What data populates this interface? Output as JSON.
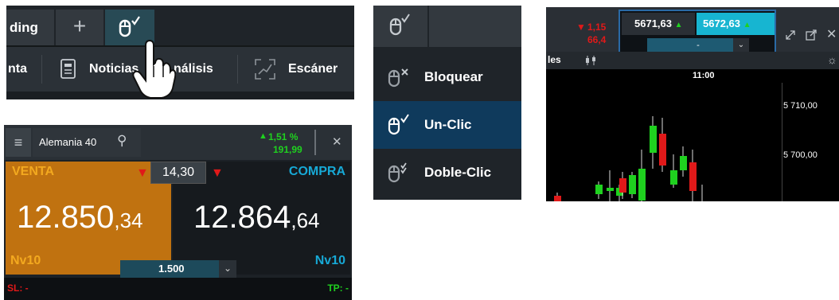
{
  "toolbar": {
    "tab_trading": "ding",
    "tab_plus": "+",
    "menu_venta": "nta",
    "menu_noticias": "Noticias",
    "menu_analisis": "nálisis",
    "menu_escaner": "Escáner"
  },
  "click_menu": {
    "options": [
      {
        "label": "Bloquear",
        "icon": "mouse-lock-icon"
      },
      {
        "label": "Un-Clic",
        "icon": "mouse-check-icon",
        "selected": true
      },
      {
        "label": "Doble-Clic",
        "icon": "mouse-double-check-icon"
      }
    ]
  },
  "chart": {
    "change_pct": "1,15",
    "change_abs": "66,4",
    "bid": "5671,63",
    "ask": "5672,63",
    "qty": "-",
    "tab_label": "les",
    "time_label": "11:00",
    "price_labels": [
      "5 710,00",
      "5 700,00"
    ],
    "colors": {
      "up": "#1fd11f",
      "down": "#e01919",
      "accent": "#17b5d1"
    }
  },
  "trade": {
    "instrument": "Alemania 40",
    "change_pct": "1,51 %",
    "change_abs": "191,99",
    "sell_label": "VENTA",
    "buy_label": "COMPRA",
    "spread": "14,30",
    "sell_main": "12.850",
    "sell_small": ",34",
    "buy_main": "12.864",
    "buy_small": ",64",
    "sell_level": "Nv10",
    "buy_level": "Nv10",
    "quantity": "1.500",
    "sl_label": "SL: -",
    "tp_label": "TP: -",
    "colors": {
      "sell": "#c07210",
      "buy_text": "#17a9d6",
      "down": "#e01919",
      "up": "#1fd11f"
    }
  }
}
